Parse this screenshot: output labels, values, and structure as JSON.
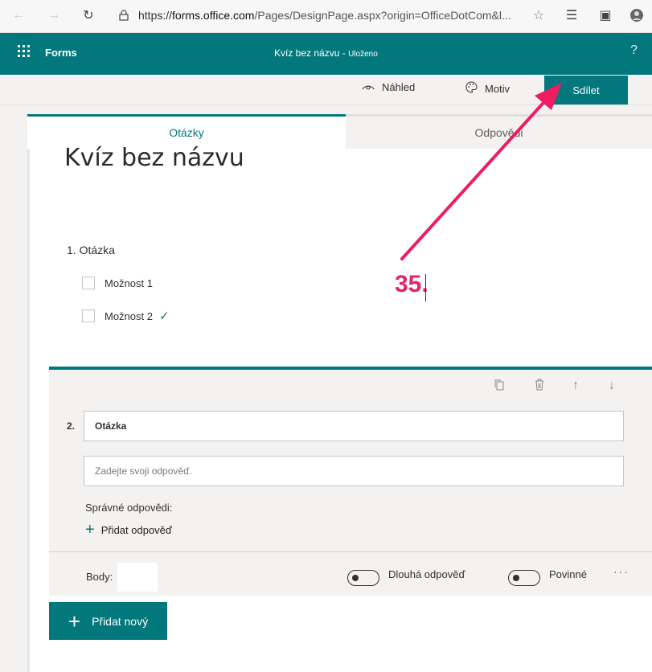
{
  "browser": {
    "url_prefix": "https://",
    "url_domain": "forms.office.com",
    "url_rest": "/Pages/DesignPage.aspx?origin=OfficeDotCom&l...",
    "icons": [
      "back-icon",
      "forward-icon",
      "refresh-icon",
      "lock-icon",
      "star-icon",
      "favorites-icon",
      "collections-icon",
      "profile-icon"
    ]
  },
  "app_bar": {
    "app_name": "Forms",
    "form_name": "Kvíz bez názvu",
    "separator": "-",
    "save_status": "Uloženo",
    "help": "?"
  },
  "command_bar": {
    "preview": "Náhled",
    "theme": "Motiv",
    "share": "Sdílet"
  },
  "tabs": {
    "questions": "Otázky",
    "responses": "Odpovědi"
  },
  "quiz": {
    "title": "Kvíz bez názvu"
  },
  "question_1": {
    "title": "1. Otázka",
    "options": [
      "Možnost 1",
      "Možnost 2"
    ],
    "correct_mark": "✓"
  },
  "question_2": {
    "number": "2.",
    "question_value": "Otázka",
    "answer_placeholder": "Zadejte svoji odpověď.",
    "correct_answers_label": "Správné odpovědi:",
    "add_answer_label": "Přidat odpověď",
    "points_label": "Body:",
    "long_answer_label": "Dlouhá odpověď",
    "required_label": "Povinné",
    "more": "···"
  },
  "actions": {
    "add_new": "Přidat nový"
  },
  "annotation": {
    "step": "35."
  },
  "colors": {
    "accent": "#03787c",
    "annotation": "#e3236a"
  }
}
